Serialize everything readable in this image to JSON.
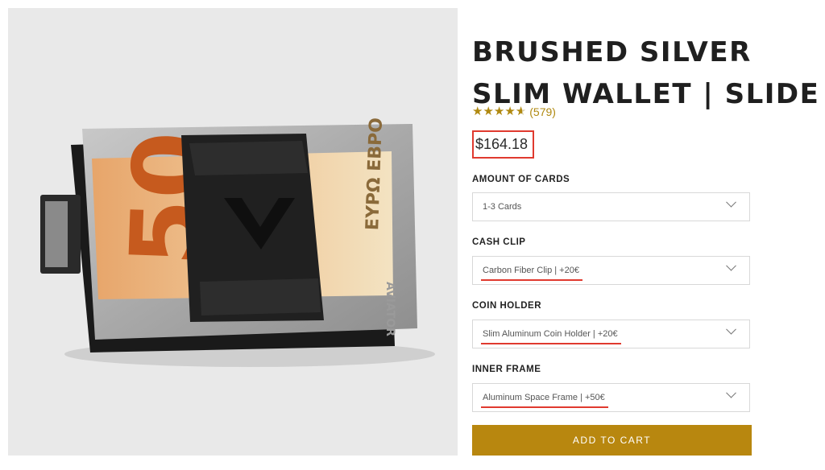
{
  "product": {
    "title": "BRUSHED SILVER SLIM WALLET | SLIDE",
    "rating_count": "(579)",
    "rating_value": 4.6,
    "price": "$164.18"
  },
  "options": [
    {
      "label": "AMOUNT OF CARDS",
      "value": "1-3 Cards"
    },
    {
      "label": "CASH CLIP",
      "value": "Carbon Fiber Clip | +20€"
    },
    {
      "label": "COIN HOLDER",
      "value": "Slim Aluminum Coin Holder | +20€"
    },
    {
      "label": "INNER FRAME",
      "value": "Aluminum Space Frame | +50€"
    }
  ],
  "cart": {
    "label": "ADD TO CART"
  },
  "image": {
    "banknote_value": "50",
    "banknote_text": "ΕΥΡΩ ЕВРО",
    "brand_engraving": "AVIATOR"
  },
  "colors": {
    "accent": "#b8870f",
    "highlight": "#e03a2f",
    "star": "#b08910"
  }
}
